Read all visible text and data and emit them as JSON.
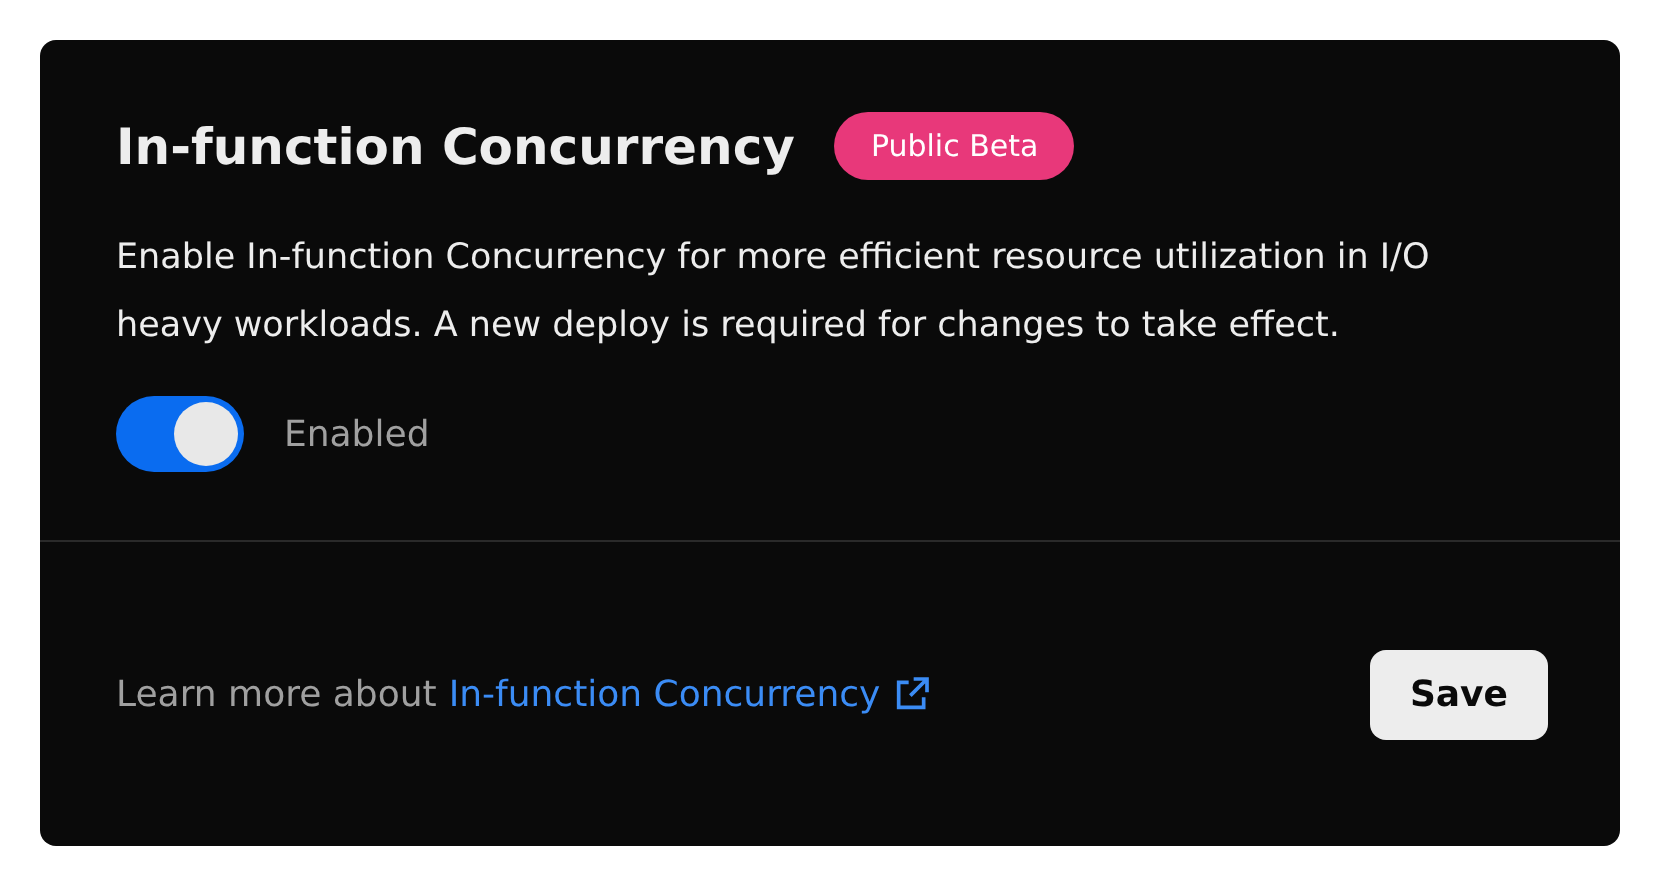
{
  "card": {
    "title": "In-function Concurrency",
    "badge": "Public Beta",
    "description": "Enable In-function Concurrency for more efficient resource utilization in I/O heavy workloads. A new deploy is required for changes to take effect.",
    "toggle": {
      "on": true,
      "label": "Enabled"
    }
  },
  "footer": {
    "text": "Learn more about",
    "link": "In-function Concurrency",
    "button": "Save"
  }
}
